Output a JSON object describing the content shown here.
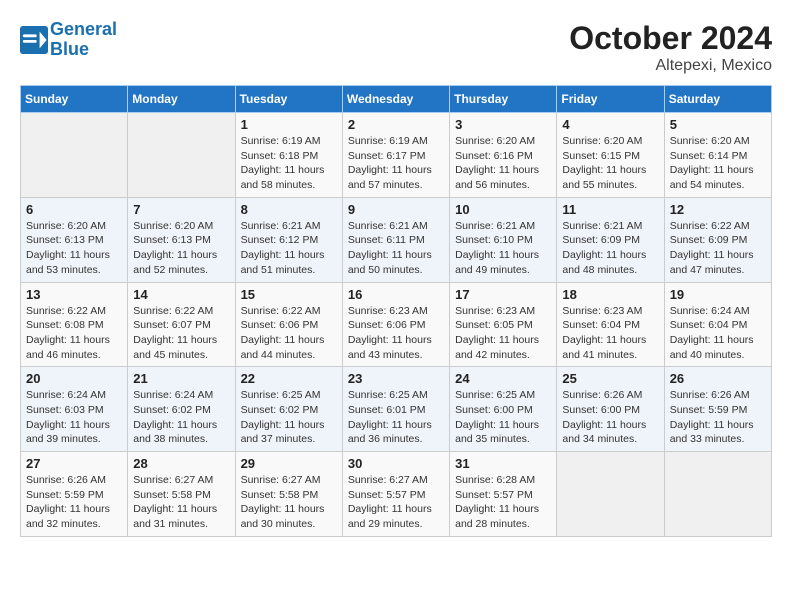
{
  "header": {
    "logo_line1": "General",
    "logo_line2": "Blue",
    "title": "October 2024",
    "subtitle": "Altepexi, Mexico"
  },
  "weekdays": [
    "Sunday",
    "Monday",
    "Tuesday",
    "Wednesday",
    "Thursday",
    "Friday",
    "Saturday"
  ],
  "weeks": [
    [
      {
        "day": "",
        "info": ""
      },
      {
        "day": "",
        "info": ""
      },
      {
        "day": "1",
        "info": "Sunrise: 6:19 AM\nSunset: 6:18 PM\nDaylight: 11 hours and 58 minutes."
      },
      {
        "day": "2",
        "info": "Sunrise: 6:19 AM\nSunset: 6:17 PM\nDaylight: 11 hours and 57 minutes."
      },
      {
        "day": "3",
        "info": "Sunrise: 6:20 AM\nSunset: 6:16 PM\nDaylight: 11 hours and 56 minutes."
      },
      {
        "day": "4",
        "info": "Sunrise: 6:20 AM\nSunset: 6:15 PM\nDaylight: 11 hours and 55 minutes."
      },
      {
        "day": "5",
        "info": "Sunrise: 6:20 AM\nSunset: 6:14 PM\nDaylight: 11 hours and 54 minutes."
      }
    ],
    [
      {
        "day": "6",
        "info": "Sunrise: 6:20 AM\nSunset: 6:13 PM\nDaylight: 11 hours and 53 minutes."
      },
      {
        "day": "7",
        "info": "Sunrise: 6:20 AM\nSunset: 6:13 PM\nDaylight: 11 hours and 52 minutes."
      },
      {
        "day": "8",
        "info": "Sunrise: 6:21 AM\nSunset: 6:12 PM\nDaylight: 11 hours and 51 minutes."
      },
      {
        "day": "9",
        "info": "Sunrise: 6:21 AM\nSunset: 6:11 PM\nDaylight: 11 hours and 50 minutes."
      },
      {
        "day": "10",
        "info": "Sunrise: 6:21 AM\nSunset: 6:10 PM\nDaylight: 11 hours and 49 minutes."
      },
      {
        "day": "11",
        "info": "Sunrise: 6:21 AM\nSunset: 6:09 PM\nDaylight: 11 hours and 48 minutes."
      },
      {
        "day": "12",
        "info": "Sunrise: 6:22 AM\nSunset: 6:09 PM\nDaylight: 11 hours and 47 minutes."
      }
    ],
    [
      {
        "day": "13",
        "info": "Sunrise: 6:22 AM\nSunset: 6:08 PM\nDaylight: 11 hours and 46 minutes."
      },
      {
        "day": "14",
        "info": "Sunrise: 6:22 AM\nSunset: 6:07 PM\nDaylight: 11 hours and 45 minutes."
      },
      {
        "day": "15",
        "info": "Sunrise: 6:22 AM\nSunset: 6:06 PM\nDaylight: 11 hours and 44 minutes."
      },
      {
        "day": "16",
        "info": "Sunrise: 6:23 AM\nSunset: 6:06 PM\nDaylight: 11 hours and 43 minutes."
      },
      {
        "day": "17",
        "info": "Sunrise: 6:23 AM\nSunset: 6:05 PM\nDaylight: 11 hours and 42 minutes."
      },
      {
        "day": "18",
        "info": "Sunrise: 6:23 AM\nSunset: 6:04 PM\nDaylight: 11 hours and 41 minutes."
      },
      {
        "day": "19",
        "info": "Sunrise: 6:24 AM\nSunset: 6:04 PM\nDaylight: 11 hours and 40 minutes."
      }
    ],
    [
      {
        "day": "20",
        "info": "Sunrise: 6:24 AM\nSunset: 6:03 PM\nDaylight: 11 hours and 39 minutes."
      },
      {
        "day": "21",
        "info": "Sunrise: 6:24 AM\nSunset: 6:02 PM\nDaylight: 11 hours and 38 minutes."
      },
      {
        "day": "22",
        "info": "Sunrise: 6:25 AM\nSunset: 6:02 PM\nDaylight: 11 hours and 37 minutes."
      },
      {
        "day": "23",
        "info": "Sunrise: 6:25 AM\nSunset: 6:01 PM\nDaylight: 11 hours and 36 minutes."
      },
      {
        "day": "24",
        "info": "Sunrise: 6:25 AM\nSunset: 6:00 PM\nDaylight: 11 hours and 35 minutes."
      },
      {
        "day": "25",
        "info": "Sunrise: 6:26 AM\nSunset: 6:00 PM\nDaylight: 11 hours and 34 minutes."
      },
      {
        "day": "26",
        "info": "Sunrise: 6:26 AM\nSunset: 5:59 PM\nDaylight: 11 hours and 33 minutes."
      }
    ],
    [
      {
        "day": "27",
        "info": "Sunrise: 6:26 AM\nSunset: 5:59 PM\nDaylight: 11 hours and 32 minutes."
      },
      {
        "day": "28",
        "info": "Sunrise: 6:27 AM\nSunset: 5:58 PM\nDaylight: 11 hours and 31 minutes."
      },
      {
        "day": "29",
        "info": "Sunrise: 6:27 AM\nSunset: 5:58 PM\nDaylight: 11 hours and 30 minutes."
      },
      {
        "day": "30",
        "info": "Sunrise: 6:27 AM\nSunset: 5:57 PM\nDaylight: 11 hours and 29 minutes."
      },
      {
        "day": "31",
        "info": "Sunrise: 6:28 AM\nSunset: 5:57 PM\nDaylight: 11 hours and 28 minutes."
      },
      {
        "day": "",
        "info": ""
      },
      {
        "day": "",
        "info": ""
      }
    ]
  ]
}
